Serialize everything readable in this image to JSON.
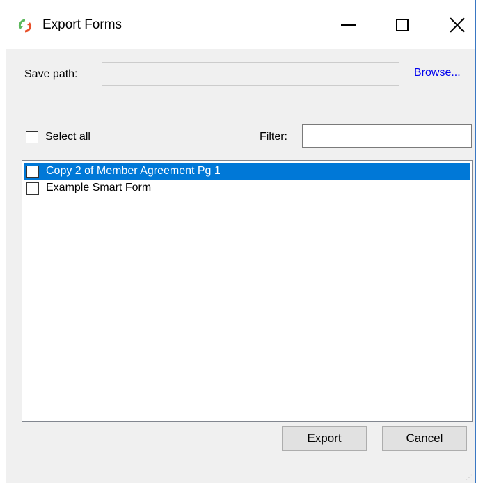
{
  "window": {
    "title": "Export Forms",
    "icon": "refresh-arrows-icon",
    "controls": [
      "minimize-icon",
      "maximize-icon",
      "close-icon"
    ]
  },
  "save_path": {
    "label": "Save path:",
    "value": "",
    "browse_label": "Browse..."
  },
  "select_all": {
    "label": "Select all",
    "checked": false
  },
  "filter": {
    "label": "Filter:",
    "value": ""
  },
  "forms": [
    {
      "label": "Copy 2 of Member Agreement Pg 1",
      "checked": false,
      "selected": true
    },
    {
      "label": "Example Smart Form",
      "checked": false,
      "selected": false
    }
  ],
  "buttons": {
    "export_label": "Export",
    "cancel_label": "Cancel"
  },
  "colors": {
    "selection": "#0078d7",
    "link": "#0000ee",
    "dialog_bg": "#f0f0f0",
    "border_accent": "#3a78c3"
  }
}
